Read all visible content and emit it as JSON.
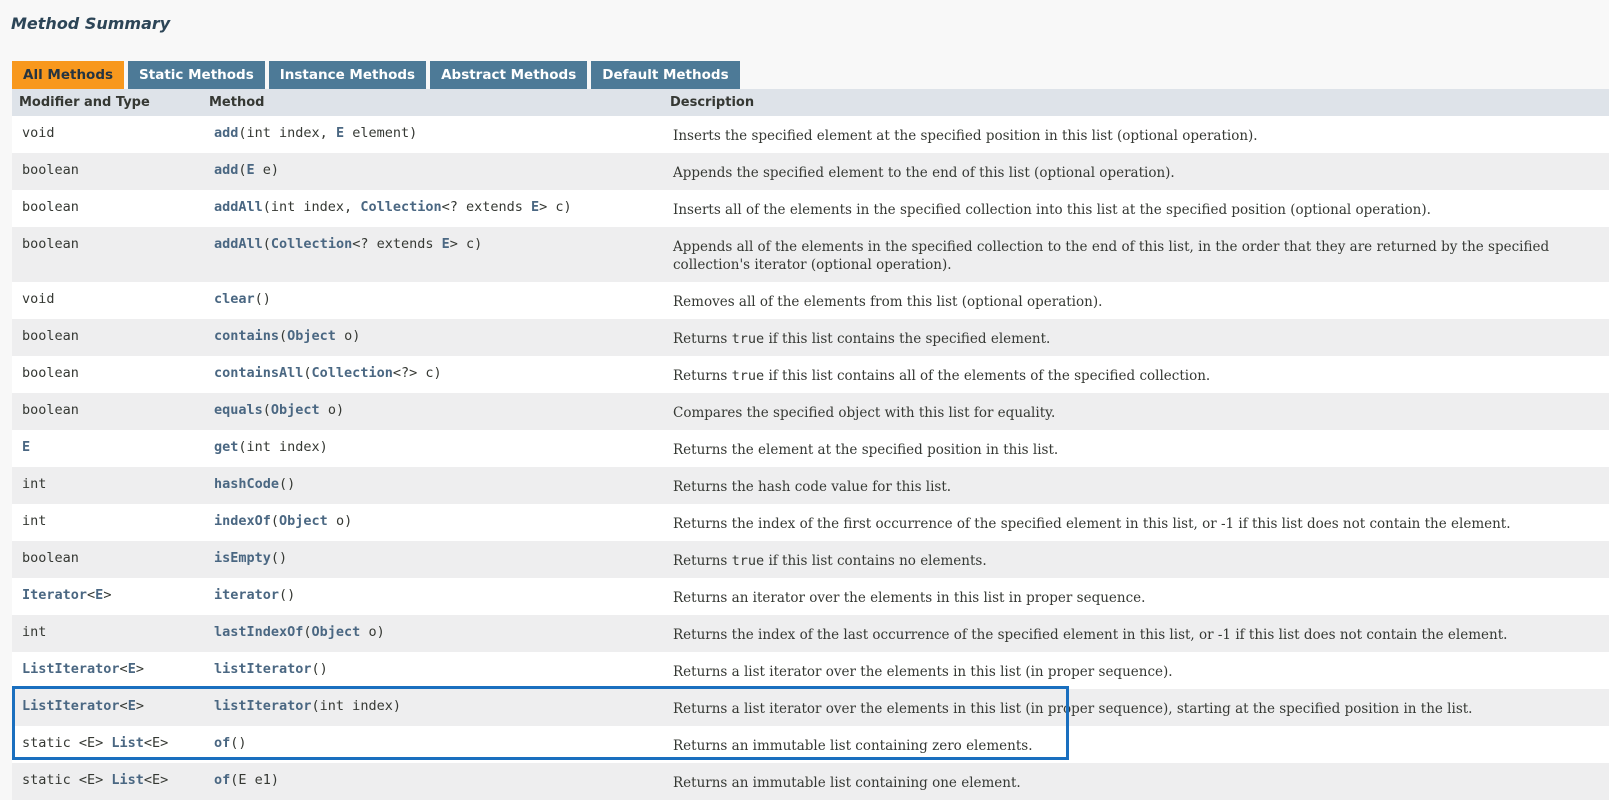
{
  "title": "Method Summary",
  "tabs": [
    "All Methods",
    "Static Methods",
    "Instance Methods",
    "Abstract Methods",
    "Default Methods"
  ],
  "columns": [
    "Modifier and Type",
    "Method",
    "Description"
  ],
  "rows": [
    {
      "type": [
        {
          "t": "void"
        }
      ],
      "method": [
        {
          "t": "add",
          "k": "name"
        },
        {
          "t": "(int index, "
        },
        {
          "t": "E",
          "k": "ref"
        },
        {
          "t": " element)"
        }
      ],
      "desc": [
        {
          "t": "Inserts the specified element at the specified position in this list (optional operation)."
        }
      ]
    },
    {
      "type": [
        {
          "t": "boolean"
        }
      ],
      "method": [
        {
          "t": "add",
          "k": "name"
        },
        {
          "t": "("
        },
        {
          "t": "E",
          "k": "ref"
        },
        {
          "t": " e)"
        }
      ],
      "desc": [
        {
          "t": "Appends the specified element to the end of this list (optional operation)."
        }
      ]
    },
    {
      "type": [
        {
          "t": "boolean"
        }
      ],
      "method": [
        {
          "t": "addAll",
          "k": "name"
        },
        {
          "t": "(int index, "
        },
        {
          "t": "Collection",
          "k": "ref"
        },
        {
          "t": "<? extends "
        },
        {
          "t": "E",
          "k": "ref"
        },
        {
          "t": "> c)"
        }
      ],
      "desc": [
        {
          "t": "Inserts all of the elements in the specified collection into this list at the specified position (optional operation)."
        }
      ]
    },
    {
      "type": [
        {
          "t": "boolean"
        }
      ],
      "method": [
        {
          "t": "addAll",
          "k": "name"
        },
        {
          "t": "("
        },
        {
          "t": "Collection",
          "k": "ref"
        },
        {
          "t": "<? extends "
        },
        {
          "t": "E",
          "k": "ref"
        },
        {
          "t": "> c)"
        }
      ],
      "desc": [
        {
          "t": "Appends all of the elements in the specified collection to the end of this list, in the order that they are returned by the specified collection's iterator (optional operation)."
        }
      ],
      "tall": true
    },
    {
      "type": [
        {
          "t": "void"
        }
      ],
      "method": [
        {
          "t": "clear",
          "k": "name"
        },
        {
          "t": "()"
        }
      ],
      "desc": [
        {
          "t": "Removes all of the elements from this list (optional operation)."
        }
      ]
    },
    {
      "type": [
        {
          "t": "boolean"
        }
      ],
      "method": [
        {
          "t": "contains",
          "k": "name"
        },
        {
          "t": "("
        },
        {
          "t": "Object",
          "k": "ref"
        },
        {
          "t": " o)"
        }
      ],
      "desc": [
        {
          "t": "Returns "
        },
        {
          "t": "true",
          "k": "code"
        },
        {
          "t": " if this list contains the specified element."
        }
      ]
    },
    {
      "type": [
        {
          "t": "boolean"
        }
      ],
      "method": [
        {
          "t": "containsAll",
          "k": "name"
        },
        {
          "t": "("
        },
        {
          "t": "Collection",
          "k": "ref"
        },
        {
          "t": "<?> c)"
        }
      ],
      "desc": [
        {
          "t": "Returns "
        },
        {
          "t": "true",
          "k": "code"
        },
        {
          "t": " if this list contains all of the elements of the specified collection."
        }
      ]
    },
    {
      "type": [
        {
          "t": "boolean"
        }
      ],
      "method": [
        {
          "t": "equals",
          "k": "name"
        },
        {
          "t": "("
        },
        {
          "t": "Object",
          "k": "ref"
        },
        {
          "t": " o)"
        }
      ],
      "desc": [
        {
          "t": "Compares the specified object with this list for equality."
        }
      ]
    },
    {
      "type": [
        {
          "t": "E",
          "k": "ref"
        }
      ],
      "method": [
        {
          "t": "get",
          "k": "name"
        },
        {
          "t": "(int index)"
        }
      ],
      "desc": [
        {
          "t": "Returns the element at the specified position in this list."
        }
      ]
    },
    {
      "type": [
        {
          "t": "int"
        }
      ],
      "method": [
        {
          "t": "hashCode",
          "k": "name"
        },
        {
          "t": "()"
        }
      ],
      "desc": [
        {
          "t": "Returns the hash code value for this list."
        }
      ]
    },
    {
      "type": [
        {
          "t": "int"
        }
      ],
      "method": [
        {
          "t": "indexOf",
          "k": "name"
        },
        {
          "t": "("
        },
        {
          "t": "Object",
          "k": "ref"
        },
        {
          "t": " o)"
        }
      ],
      "desc": [
        {
          "t": "Returns the index of the first occurrence of the specified element in this list, or -1 if this list does not contain the element."
        }
      ]
    },
    {
      "type": [
        {
          "t": "boolean"
        }
      ],
      "method": [
        {
          "t": "isEmpty",
          "k": "name"
        },
        {
          "t": "()"
        }
      ],
      "desc": [
        {
          "t": "Returns "
        },
        {
          "t": "true",
          "k": "code"
        },
        {
          "t": " if this list contains no elements."
        }
      ]
    },
    {
      "type": [
        {
          "t": "Iterator",
          "k": "ref"
        },
        {
          "t": "<"
        },
        {
          "t": "E",
          "k": "ref"
        },
        {
          "t": ">"
        }
      ],
      "method": [
        {
          "t": "iterator",
          "k": "name"
        },
        {
          "t": "()"
        }
      ],
      "desc": [
        {
          "t": "Returns an iterator over the elements in this list in proper sequence."
        }
      ]
    },
    {
      "type": [
        {
          "t": "int"
        }
      ],
      "method": [
        {
          "t": "lastIndexOf",
          "k": "name"
        },
        {
          "t": "("
        },
        {
          "t": "Object",
          "k": "ref"
        },
        {
          "t": " o)"
        }
      ],
      "desc": [
        {
          "t": "Returns the index of the last occurrence of the specified element in this list, or -1 if this list does not contain the element."
        }
      ]
    },
    {
      "type": [
        {
          "t": "ListIterator",
          "k": "ref"
        },
        {
          "t": "<"
        },
        {
          "t": "E",
          "k": "ref"
        },
        {
          "t": ">"
        }
      ],
      "method": [
        {
          "t": "listIterator",
          "k": "name"
        },
        {
          "t": "()"
        }
      ],
      "desc": [
        {
          "t": "Returns a list iterator over the elements in this list (in proper sequence)."
        }
      ]
    },
    {
      "type": [
        {
          "t": "ListIterator",
          "k": "ref"
        },
        {
          "t": "<"
        },
        {
          "t": "E",
          "k": "ref"
        },
        {
          "t": ">"
        }
      ],
      "method": [
        {
          "t": "listIterator",
          "k": "name"
        },
        {
          "t": "(int index)"
        }
      ],
      "desc": [
        {
          "t": "Returns a list iterator over the elements in this list (in proper sequence), starting at the specified position in the list."
        }
      ]
    },
    {
      "type": [
        {
          "t": "static <E> "
        },
        {
          "t": "List",
          "k": "ref"
        },
        {
          "t": "<E>"
        }
      ],
      "method": [
        {
          "t": "of",
          "k": "name"
        },
        {
          "t": "()"
        }
      ],
      "desc": [
        {
          "t": "Returns an immutable list containing zero elements."
        }
      ]
    },
    {
      "type": [
        {
          "t": "static <E> "
        },
        {
          "t": "List",
          "k": "ref"
        },
        {
          "t": "<E>"
        }
      ],
      "method": [
        {
          "t": "of",
          "k": "name"
        },
        {
          "t": "(E e1)"
        }
      ],
      "desc": [
        {
          "t": "Returns an immutable list containing one element."
        }
      ]
    }
  ],
  "colors": {
    "active_tab": "#f8981d",
    "tab": "#4d7a97",
    "header_row": "#dee3e9",
    "highlight_border": "#1a6fbf",
    "link": "#4a6782"
  }
}
